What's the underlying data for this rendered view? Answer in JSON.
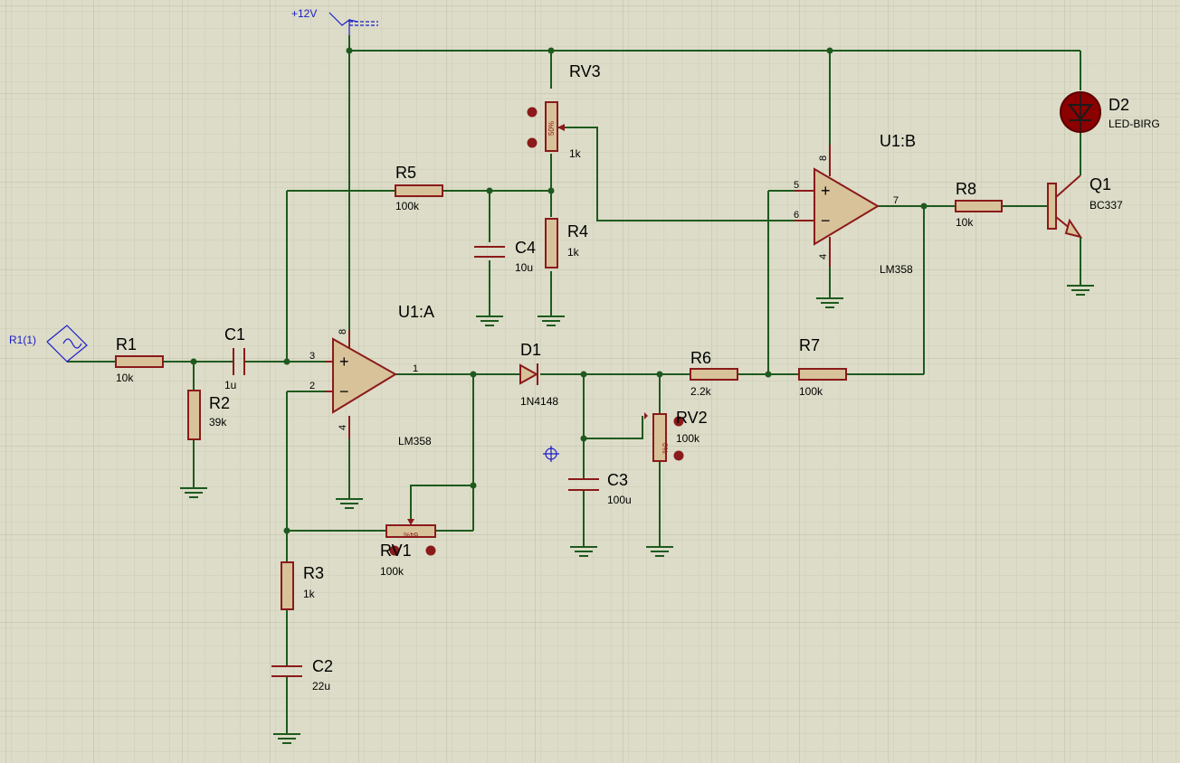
{
  "supply": {
    "label": "+12V"
  },
  "source": {
    "label": "R1(1)"
  },
  "components": {
    "R1": {
      "name": "R1",
      "value": "10k"
    },
    "R2": {
      "name": "R2",
      "value": "39k"
    },
    "R3": {
      "name": "R3",
      "value": "1k"
    },
    "R4": {
      "name": "R4",
      "value": "1k"
    },
    "R5": {
      "name": "R5",
      "value": "100k"
    },
    "R6": {
      "name": "R6",
      "value": "2.2k"
    },
    "R7": {
      "name": "R7",
      "value": "100k"
    },
    "R8": {
      "name": "R8",
      "value": "10k"
    },
    "C1": {
      "name": "C1",
      "value": "1u"
    },
    "C2": {
      "name": "C2",
      "value": "22u"
    },
    "C3": {
      "name": "C3",
      "value": "100u"
    },
    "C4": {
      "name": "C4",
      "value": "10u"
    },
    "D1": {
      "name": "D1",
      "value": "1N4148"
    },
    "D2": {
      "name": "D2",
      "value": "LED-BIRG"
    },
    "Q1": {
      "name": "Q1",
      "value": "BC337"
    },
    "RV1": {
      "name": "RV1",
      "value": "100k",
      "wiper": "64%"
    },
    "RV2": {
      "name": "RV2",
      "value": "100k",
      "wiper": "0%"
    },
    "RV3": {
      "name": "RV3",
      "value": "1k",
      "wiper": "50%"
    },
    "U1A": {
      "name": "U1:A",
      "value": "LM358",
      "pins": {
        "noninv": "3",
        "inv": "2",
        "out": "1",
        "vcc": "8",
        "gnd": "4"
      }
    },
    "U1B": {
      "name": "U1:B",
      "value": "LM358",
      "pins": {
        "noninv": "5",
        "inv": "6",
        "out": "7",
        "vcc": "8",
        "gnd": "4"
      }
    }
  },
  "colors": {
    "background": "#dcdcc8",
    "grid": "#c8c8b4",
    "wire": "#1e5a1e",
    "component": "#8b1a1a",
    "fill": "#d8c29a",
    "probe": "#1a1acc"
  }
}
